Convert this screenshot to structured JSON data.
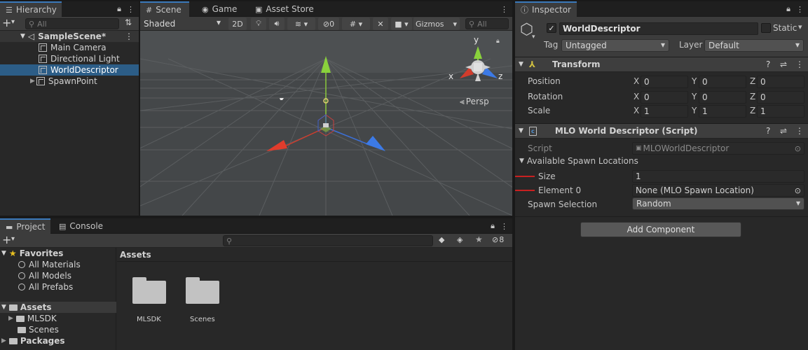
{
  "hierarchy": {
    "tab_label": "Hierarchy",
    "add_symbol": "+",
    "search_placeholder": "All",
    "scene_name": "SampleScene*",
    "items": [
      {
        "label": "Main Camera"
      },
      {
        "label": "Directional Light"
      },
      {
        "label": "WorldDescriptor"
      },
      {
        "label": "SpawnPoint"
      }
    ]
  },
  "scene": {
    "tabs": [
      {
        "label": "Scene"
      },
      {
        "label": "Game"
      },
      {
        "label": "Asset Store"
      }
    ],
    "shading_mode": "Shaded",
    "mode_2d": "2D",
    "hidden_count": "0",
    "gizmos_label": "Gizmos",
    "search_placeholder": "All",
    "persp_label": "Persp",
    "gizmo_labels": {
      "y": "y",
      "x": "x",
      "z": "z"
    }
  },
  "project": {
    "tabs": [
      {
        "label": "Project"
      },
      {
        "label": "Console"
      }
    ],
    "add_symbol": "+",
    "hidden_count": "8",
    "favorites_label": "Favorites",
    "favorites": [
      {
        "label": "All Materials"
      },
      {
        "label": "All Models"
      },
      {
        "label": "All Prefabs"
      }
    ],
    "assets_label": "Assets",
    "asset_children": [
      {
        "label": "MLSDK"
      },
      {
        "label": "Scenes"
      }
    ],
    "packages_label": "Packages",
    "breadcrumb": "Assets",
    "folders": [
      {
        "label": "MLSDK"
      },
      {
        "label": "Scenes"
      }
    ]
  },
  "inspector": {
    "tab_label": "Inspector",
    "object_name": "WorldDescriptor",
    "static_label": "Static",
    "tag_label": "Tag",
    "tag_value": "Untagged",
    "layer_label": "Layer",
    "layer_value": "Default",
    "transform": {
      "title": "Transform",
      "rows": [
        {
          "label": "Position",
          "x": "0",
          "y": "0",
          "z": "0"
        },
        {
          "label": "Rotation",
          "x": "0",
          "y": "0",
          "z": "0"
        },
        {
          "label": "Scale",
          "x": "1",
          "y": "1",
          "z": "1"
        }
      ],
      "axis_labels": {
        "x": "X",
        "y": "Y",
        "z": "Z"
      }
    },
    "script_component": {
      "title": "MLO World Descriptor (Script)",
      "script_label": "Script",
      "script_value": "MLOWorldDescriptor",
      "spawn_locations_label": "Available Spawn Locations",
      "size_label": "Size",
      "size_value": "1",
      "element0_label": "Element 0",
      "element0_value": "None (MLO Spawn Location)",
      "spawn_selection_label": "Spawn Selection",
      "spawn_selection_value": "Random"
    },
    "add_component_label": "Add Component"
  },
  "colors": {
    "selection": "#2c5d87",
    "accent_tab": "#3a79bb",
    "annotation_red": "#c82020"
  }
}
